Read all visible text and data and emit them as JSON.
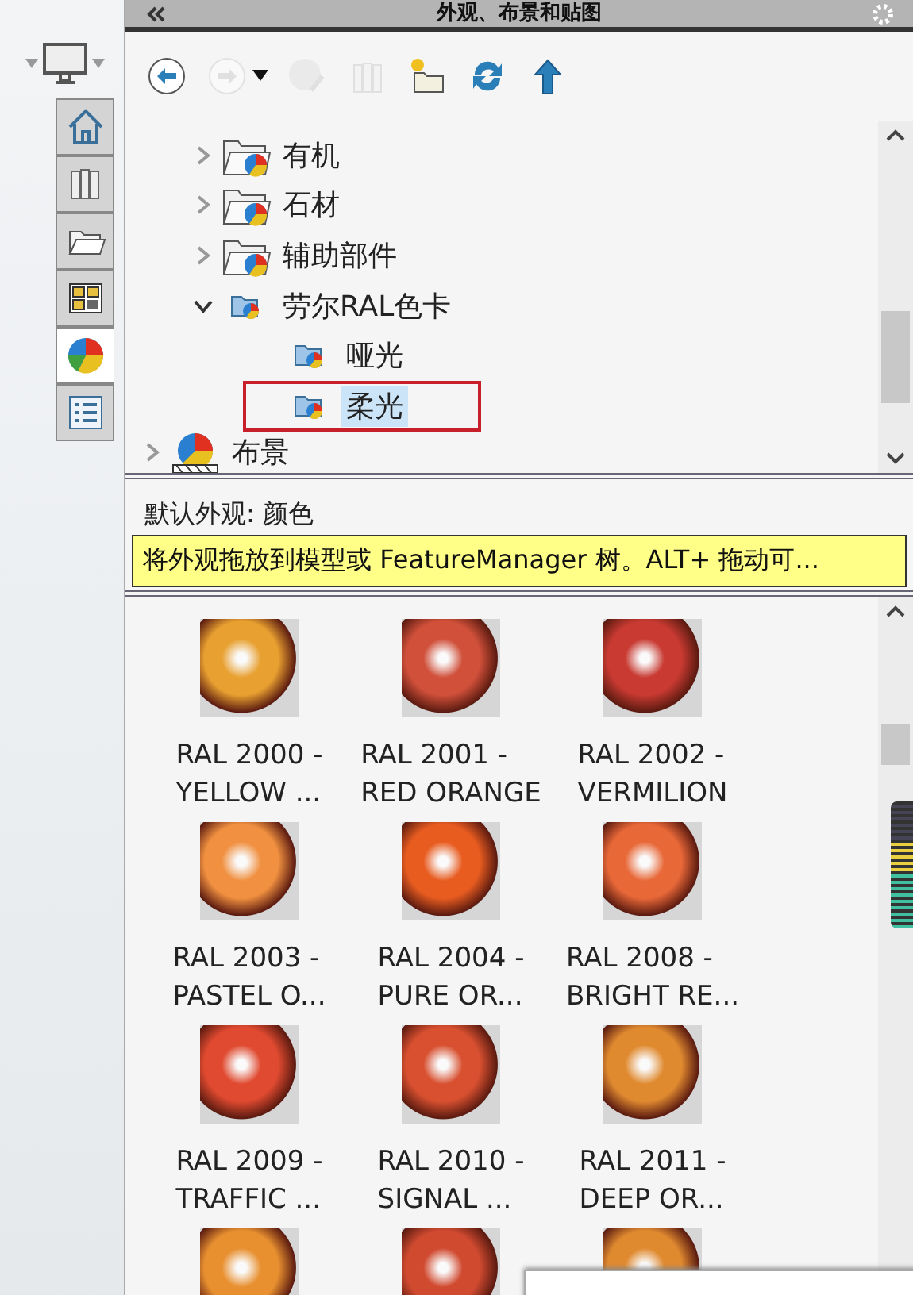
{
  "window": {
    "title": "外观、布景和贴图"
  },
  "side_tabs": [
    {
      "kind": "home",
      "selected": false
    },
    {
      "kind": "books",
      "selected": false
    },
    {
      "kind": "folder",
      "selected": false
    },
    {
      "kind": "layout",
      "selected": false
    },
    {
      "kind": "ball",
      "selected": true
    },
    {
      "kind": "list",
      "selected": false
    }
  ],
  "toolbar": [
    {
      "kind": "back",
      "disabled": false
    },
    {
      "kind": "forward",
      "disabled": true
    },
    {
      "kind": "sphere",
      "disabled": true
    },
    {
      "kind": "books",
      "disabled": true
    },
    {
      "kind": "new-folder",
      "disabled": false
    },
    {
      "kind": "refresh",
      "disabled": false
    },
    {
      "kind": "up",
      "disabled": false
    }
  ],
  "tree": {
    "items": [
      {
        "label": "有机",
        "kind": "folder",
        "expanded": false,
        "selected": false
      },
      {
        "label": "石材",
        "kind": "folder",
        "expanded": false,
        "selected": false
      },
      {
        "label": "辅助部件",
        "kind": "folder",
        "expanded": false,
        "selected": false
      },
      {
        "label": "劳尔RAL色卡",
        "kind": "library",
        "expanded": true,
        "selected": false,
        "children": [
          {
            "label": "哑光",
            "kind": "library",
            "selected": false
          },
          {
            "label": "柔光",
            "kind": "library",
            "selected": true
          }
        ]
      }
    ],
    "root_item": {
      "label": "布景",
      "kind": "scene",
      "expanded": false,
      "selected": false
    }
  },
  "info": {
    "label": "默认外观: 颜色",
    "tooltip": "将外观拖放到模型或 FeatureManager 树。ALT+ 拖动可..."
  },
  "swatches": [
    {
      "line1": "RAL 2000 -",
      "line2": "YELLOW ...",
      "color": "#e8a030"
    },
    {
      "line1": "RAL 2001 -",
      "line2": "RED ORANGE",
      "color": "#d0503a"
    },
    {
      "line1": "RAL 2002 -",
      "line2": "VERMILION",
      "color": "#c83a32"
    },
    {
      "line1": "RAL 2003 -",
      "line2": "PASTEL O...",
      "color": "#f09040"
    },
    {
      "line1": "RAL 2004 -",
      "line2": "PURE OR...",
      "color": "#e85c20"
    },
    {
      "line1": "RAL 2008 -",
      "line2": "BRIGHT RE...",
      "color": "#e86838"
    },
    {
      "line1": "RAL 2009 -",
      "line2": "TRAFFIC ...",
      "color": "#e04a30"
    },
    {
      "line1": "RAL 2010 -",
      "line2": "SIGNAL ...",
      "color": "#d85030"
    },
    {
      "line1": "RAL 2011 -",
      "line2": "DEEP OR...",
      "color": "#e08a30"
    }
  ],
  "partial_swatches": [
    {
      "color": "#e89030"
    },
    {
      "color": "#d04a30"
    },
    {
      "color": "#e08a30"
    }
  ]
}
